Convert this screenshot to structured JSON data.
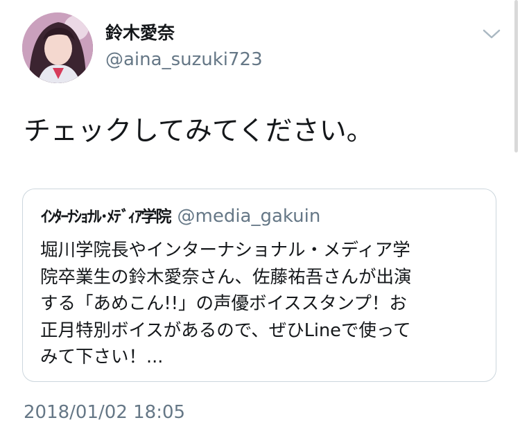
{
  "tweet": {
    "author": {
      "display_name": "鈴木愛奈",
      "handle": "@aina_suzuki723",
      "avatar_icon": "profile-photo"
    },
    "menu_icon": "chevron-down-icon",
    "text": "チェックしてみてください。",
    "timestamp": "2018/01/02 18:05"
  },
  "quote": {
    "author_name": "ｲﾝﾀｰﾅｼｮﾅﾙ･ﾒﾃﾞｨｱ学院",
    "author_handle": "@media_gakuin",
    "lines": [
      "堀川学院長やインターナショナル・メディア学",
      "院卒業生の鈴木愛奈さん、佐藤祐吾さんが出演",
      "する「あめこん!!」の声優ボイススタンプ！お",
      "正月特別ボイスがあるので、ぜひLineで使って",
      "みて下さい！..."
    ]
  },
  "colors": {
    "text_primary": "#14171a",
    "text_secondary": "#657786",
    "border": "#ccd6dd"
  }
}
